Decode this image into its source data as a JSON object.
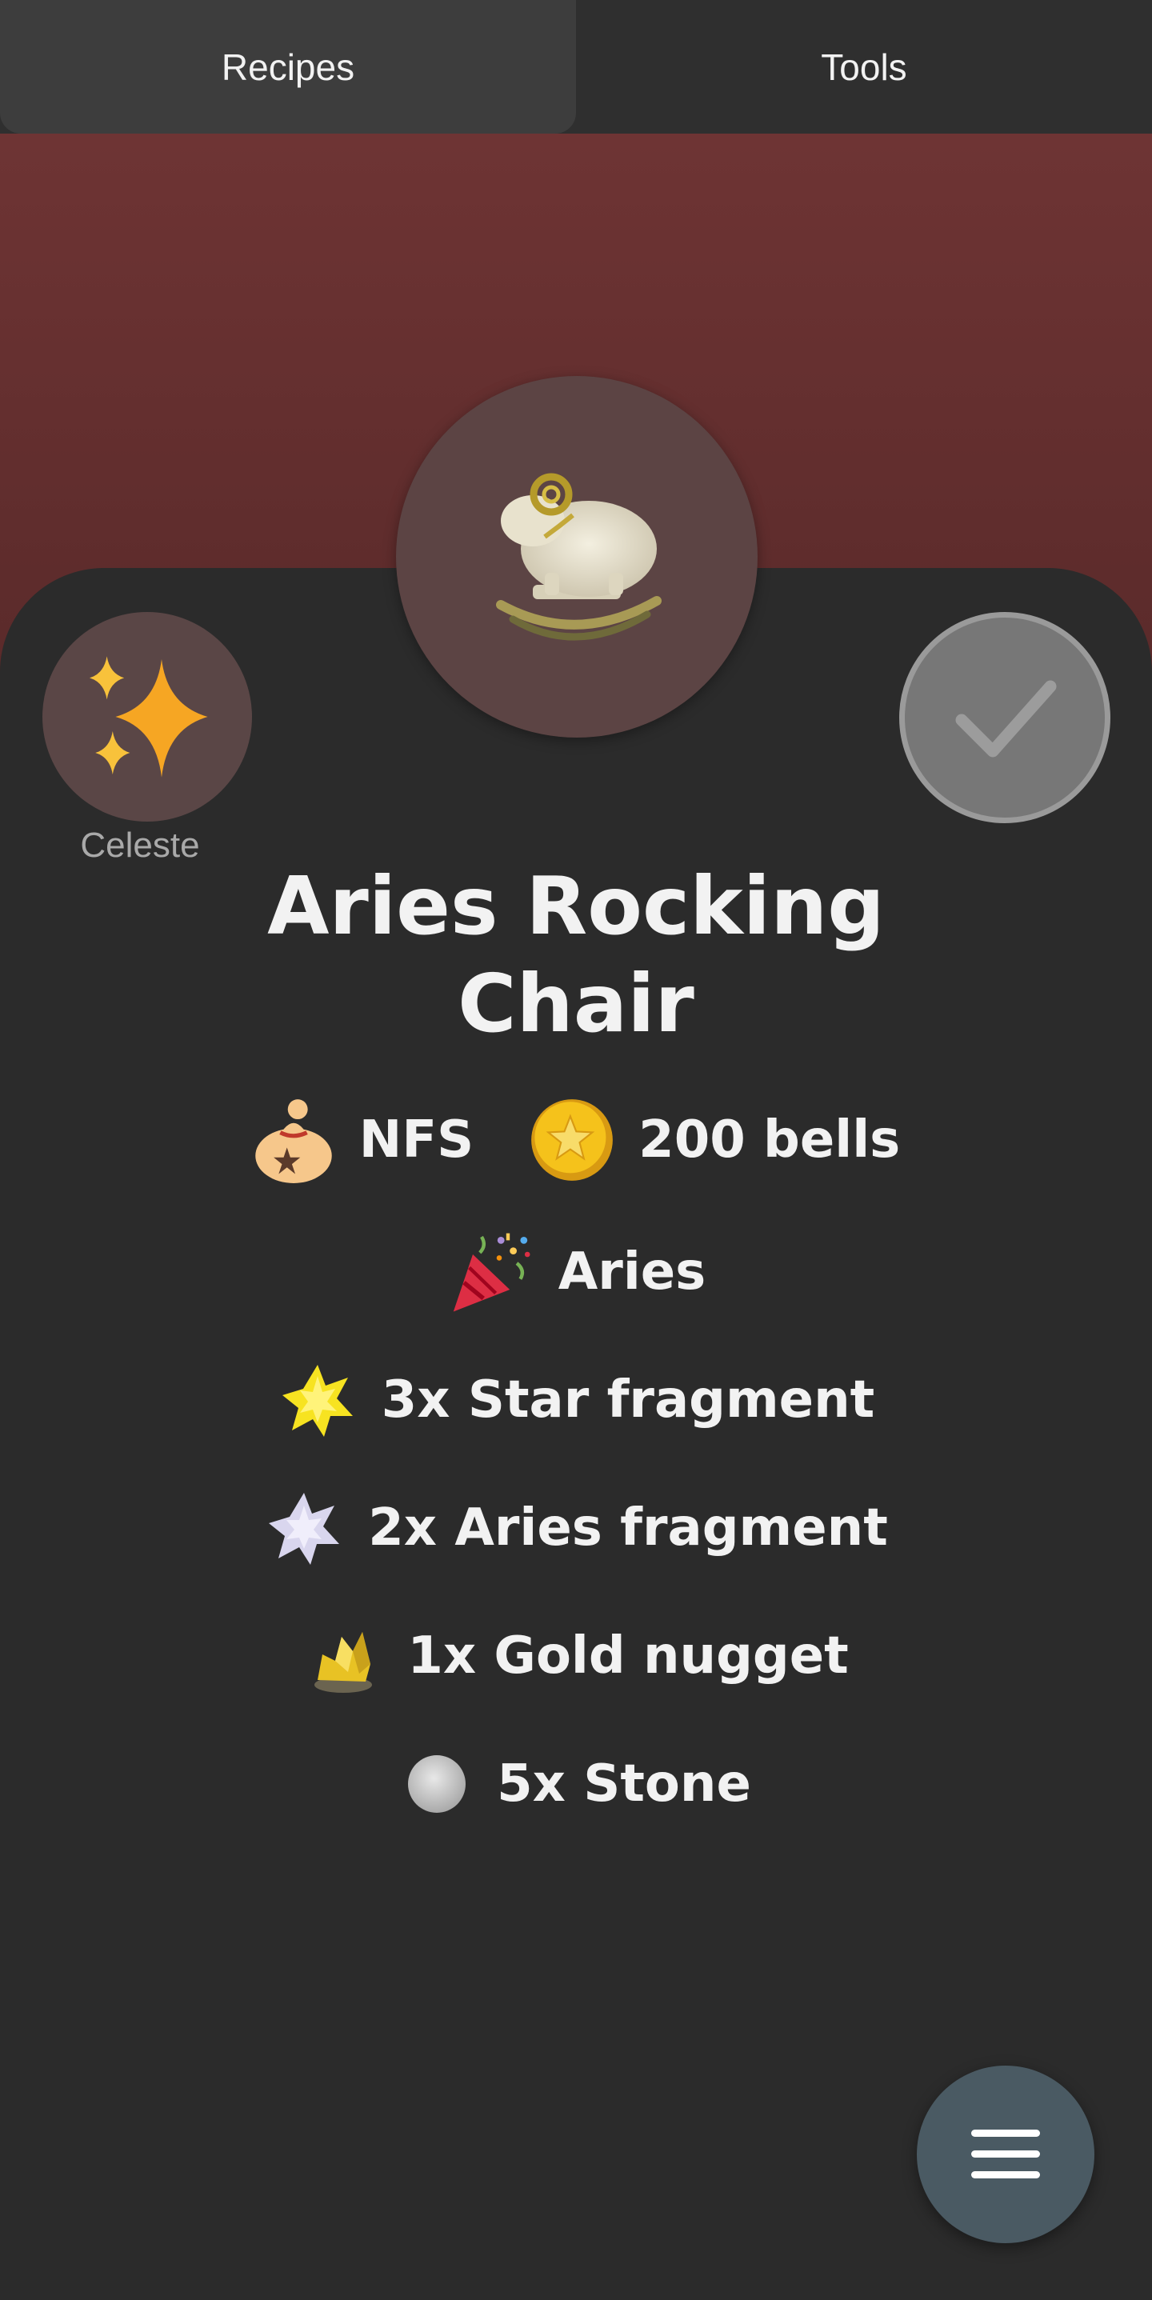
{
  "tabs": [
    {
      "label": "Recipes",
      "active": true
    },
    {
      "label": "Tools",
      "active": false
    }
  ],
  "colors": {
    "banner": "#6e3434",
    "card": "#2b2b2b",
    "tab_active": "#3d3d3d",
    "fab": "#4a5a63",
    "check_button": "#777777"
  },
  "item": {
    "image_icon": "aries-rocking-chair-icon",
    "name": "Aries Rocking Chair",
    "source": {
      "icon": "sparkles-icon",
      "label": "Celeste"
    },
    "collected_icon": "checkmark-icon",
    "sell": {
      "icon": "money-bag-icon",
      "label": "NFS"
    },
    "price": {
      "icon": "bell-coin-icon",
      "label": "200 bells"
    },
    "season": {
      "icon": "party-popper-icon",
      "label": "Aries"
    },
    "materials": [
      {
        "icon": "star-fragment-icon",
        "label": "3x Star fragment"
      },
      {
        "icon": "aries-fragment-icon",
        "label": "2x Aries fragment"
      },
      {
        "icon": "gold-nugget-icon",
        "label": "1x Gold nugget"
      },
      {
        "icon": "stone-icon",
        "label": "5x Stone"
      }
    ]
  },
  "menu_button_icon": "hamburger-menu-icon"
}
